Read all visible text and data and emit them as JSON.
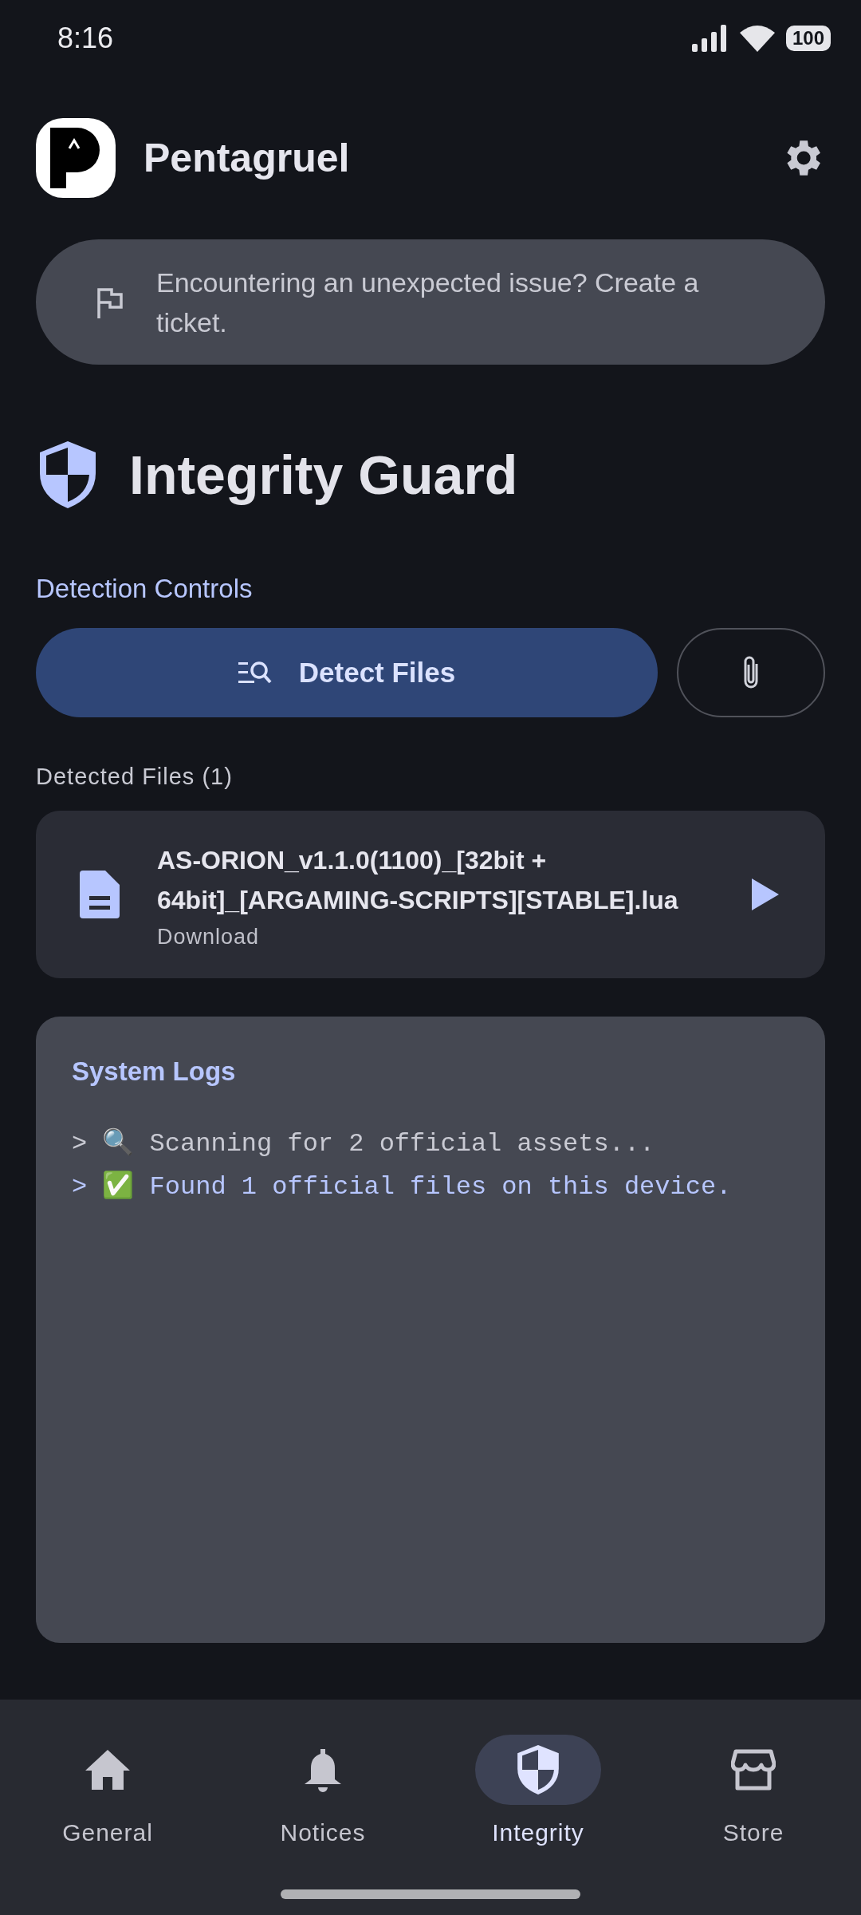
{
  "status_bar": {
    "time": "8:16",
    "battery": "100"
  },
  "app_bar": {
    "title": "Pentagruel"
  },
  "banner": {
    "text": "Encountering an unexpected issue? Create a ticket."
  },
  "heading": "Integrity Guard",
  "detection_controls": {
    "label": "Detection Controls",
    "detect_button": "Detect Files"
  },
  "detected_files": {
    "label": "Detected Files (1)",
    "files": [
      {
        "name": "AS-ORION_v1.1.0(1100)_[32bit + 64bit]_[ARGAMING-SCRIPTS][STABLE].lua",
        "folder": "Download"
      }
    ]
  },
  "system_logs": {
    "title": "System Logs",
    "lines": [
      {
        "kind": "info",
        "text": "> 🔍 Scanning for 2 official assets..."
      },
      {
        "kind": "success",
        "text": "> ✅ Found 1 official files on this device."
      }
    ]
  },
  "nav": [
    {
      "kind": "home",
      "label": "General",
      "selected": false
    },
    {
      "kind": "bell",
      "label": "Notices",
      "selected": false
    },
    {
      "kind": "shield",
      "label": "Integrity",
      "selected": true
    },
    {
      "kind": "store",
      "label": "Store",
      "selected": false
    }
  ]
}
